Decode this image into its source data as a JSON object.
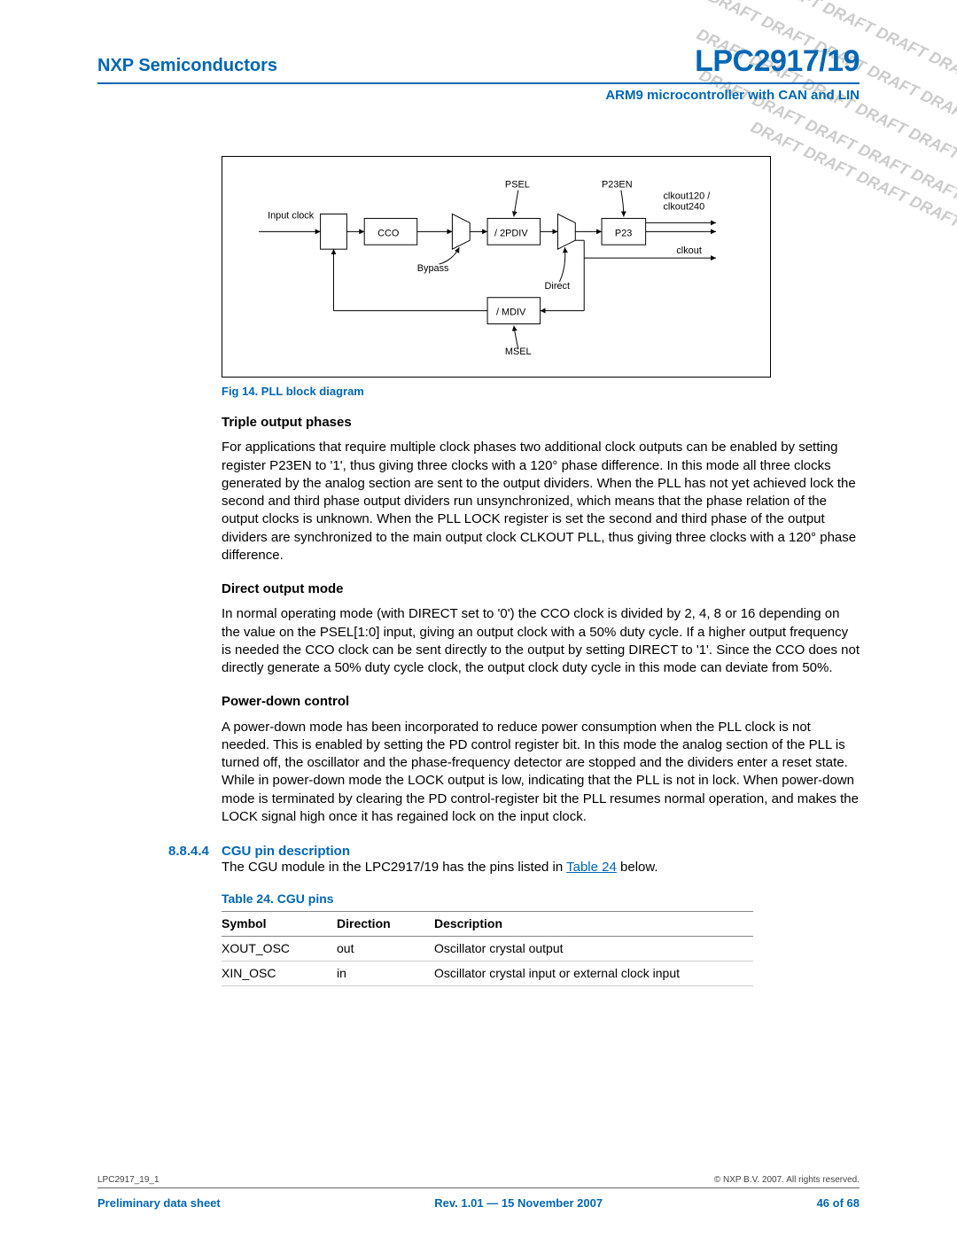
{
  "header": {
    "company": "NXP Semiconductors",
    "part": "LPC2917/19",
    "subtitle": "ARM9 microcontroller with CAN and LIN"
  },
  "watermark": "DRAFT",
  "figure": {
    "caption": "Fig 14. PLL block diagram",
    "labels": {
      "input_clock": "Input clock",
      "cco": "CCO",
      "bypass": "Bypass",
      "div2p": "/ 2PDIV",
      "psel": "PSEL",
      "direct": "Direct",
      "mdiv": "/ MDIV",
      "msel": "MSEL",
      "p23": "P23",
      "p23en": "P23EN",
      "clk120": "clkout120 /",
      "clk240": "clkout240",
      "clkout": "clkout"
    }
  },
  "sections": {
    "triple": {
      "title": "Triple output phases",
      "para": "For applications that require multiple clock phases two additional clock outputs can be enabled by setting register P23EN to '1', thus giving three clocks with a 120° phase difference. In this mode all three clocks generated by the analog section are sent to the output dividers. When the PLL has not yet achieved lock the second and third phase output dividers run unsynchronized, which means that the phase relation of the output clocks is unknown. When the PLL LOCK register is set the second and third phase of the output dividers are synchronized to the main output clock CLKOUT PLL, thus giving three clocks with a 120° phase difference."
    },
    "direct": {
      "title": "Direct output mode",
      "para": "In normal operating mode (with DIRECT set to '0') the CCO clock is divided by 2, 4, 8 or 16 depending on the value on the PSEL[1:0] input, giving an output clock with a 50% duty cycle. If a higher output frequency is needed the CCO clock can be sent directly to the output by setting DIRECT to '1'. Since the CCO does not directly generate a 50% duty cycle clock, the output clock duty cycle in this mode can deviate from 50%."
    },
    "power": {
      "title": "Power-down control",
      "para": "A power-down mode has been incorporated to reduce power consumption when the PLL clock is not needed. This is enabled by setting the PD control register bit. In this mode the analog section of the PLL is turned off, the oscillator and the phase-frequency detector are stopped and the dividers enter a reset state. While in power-down mode the LOCK output is low, indicating that the PLL is not in lock. When power-down mode is terminated by clearing the PD control-register bit the PLL resumes normal operation, and makes the LOCK signal high once it has regained lock on the input clock."
    },
    "cgu": {
      "num": "8.8.4.4",
      "title": "CGU pin description",
      "intro_pre": "The CGU module in the LPC2917/19 has the pins listed in ",
      "intro_link": "Table 24",
      "intro_post": " below."
    }
  },
  "table": {
    "caption": "Table 24.   CGU pins",
    "headers": [
      "Symbol",
      "Direction",
      "Description"
    ],
    "rows": [
      {
        "symbol": "XOUT_OSC",
        "direction": "out",
        "description": "Oscillator crystal output"
      },
      {
        "symbol": "XIN_OSC",
        "direction": "in",
        "description": "Oscillator crystal input or external clock input"
      }
    ]
  },
  "footer": {
    "docid": "LPC2917_19_1",
    "copyright": "© NXP B.V. 2007. All rights reserved.",
    "left": "Preliminary data sheet",
    "center": "Rev. 1.01 — 15 November 2007",
    "right": "46 of 68"
  }
}
